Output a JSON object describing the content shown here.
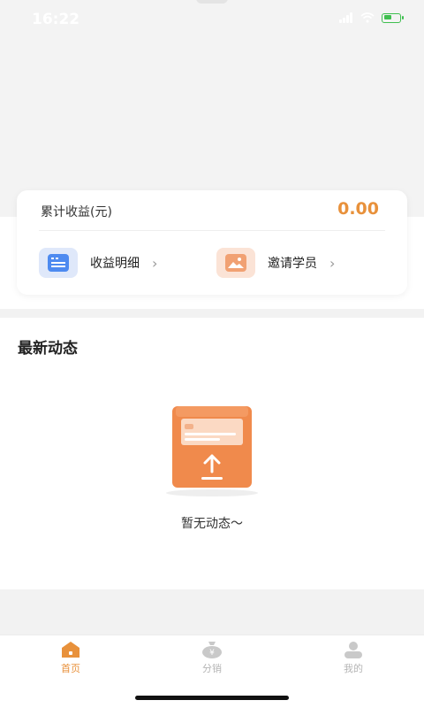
{
  "status_bar": {
    "time": "16:22"
  },
  "earnings": {
    "label": "累计收益(元)",
    "value": "0.00",
    "accent_color": "#e8913b",
    "links": [
      {
        "label": "收益明细",
        "icon": "list-icon"
      },
      {
        "label": "邀请学员",
        "icon": "image-icon"
      }
    ]
  },
  "feed": {
    "title": "最新动态",
    "empty_text": "暂无动态～",
    "empty_icon": "upload-box-icon"
  },
  "tab_bar": {
    "active_color": "#e8913b",
    "inactive_color": "#b5b5b5",
    "tabs": [
      {
        "label": "首页",
        "icon": "home-icon",
        "active": true
      },
      {
        "label": "分销",
        "icon": "money-bag-icon",
        "active": false
      },
      {
        "label": "我的",
        "icon": "user-icon",
        "active": false
      }
    ]
  }
}
